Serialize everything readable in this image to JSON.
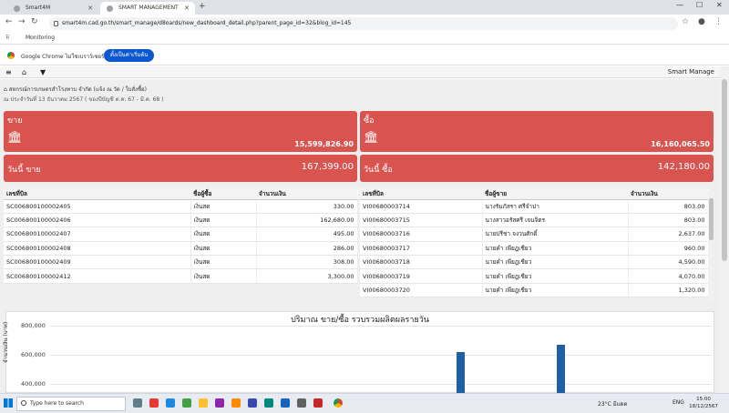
{
  "browser": {
    "tabs": [
      {
        "label": "Smart4M"
      },
      {
        "label": "SMART MANAGEMENT"
      }
    ],
    "url": "smart4m.cad.go.th/smart_manage/d8oards/new_dashboard_detail.php?parent_page_id=32&blog_id=145",
    "bookmark": "Monitoring",
    "infobar_text": "Google Chrome ไม่ใช่เบราว์เซอร์เริ่มต้น",
    "infobar_button": "ตั้งเป็นค่าเริ่มต้น"
  },
  "app": {
    "brand": "Smart Manage",
    "breadcrumb": "สหกรณ์การเกษตรสำโรงทาบ จำกัด (แจ้ง ณ วัด / ใบสั่งซื้อ)",
    "dateline": "ณ ประจำวันที่ 13 ธันวาคม 2567 ( ของปีบัญชี ต.ค. 67 - มี.ค. 68 )"
  },
  "sell": {
    "label": "ขาย",
    "total": "15,599,826.90",
    "today_label": "วันนี้ ขาย",
    "today_amount": "167,399.00",
    "table": {
      "headers": [
        "เลขที่บิล",
        "ชื่อผู้ซื้อ",
        "จำนวนเงิน"
      ],
      "rows": [
        [
          "SC006800100002405",
          "เงินสด",
          "330.00"
        ],
        [
          "SC006800100002406",
          "เงินสด",
          "162,680.00"
        ],
        [
          "SC006800100002407",
          "เงินสด",
          "495.00"
        ],
        [
          "SC006800100002408",
          "เงินสด",
          "286.00"
        ],
        [
          "SC006800100002409",
          "เงินสด",
          "308.00"
        ],
        [
          "SC006800100002412",
          "เงินสด",
          "3,300.00"
        ]
      ]
    }
  },
  "buy": {
    "label": "ซื้อ",
    "total": "16,160,065.50",
    "today_label": "วันนี้ ซื้อ",
    "today_amount": "142,180.00",
    "table": {
      "headers": [
        "เลขที่บิล",
        "ชื่อผู้ขาย",
        "จำนวนเงิน"
      ],
      "rows": [
        [
          "VI00680003714",
          "นางรัมภัสรา ศรีจำปา",
          "803.00"
        ],
        [
          "VI00680003715",
          "นางสาวอรัสศรี เจนจิตร",
          "803.00"
        ],
        [
          "VI00680003716",
          "นายปรีชา จงวนศักดิ์",
          "2,637.00"
        ],
        [
          "VI00680003717",
          "นายคำ เพียฎเชียว",
          "960.00"
        ],
        [
          "VI00680003718",
          "นายคำ เพียฎเชียว",
          "4,590.00"
        ],
        [
          "VI00680003719",
          "นายคำ เพียฎเชียว",
          "4,070.00"
        ],
        [
          "VI00680003720",
          "นายคำ เพียฎเชียว",
          "1,320.00"
        ]
      ]
    }
  },
  "chart_data": {
    "type": "bar",
    "title": "ปริมาณ ขาย/ซื้อ รวบรวมผลิตผลรายวัน",
    "ylabel": "จำนวนเงิน (บาท)",
    "yticks": [
      "800,000",
      "600,000",
      "400,000"
    ],
    "ylim_visible": [
      330000,
      800000
    ],
    "series": [
      {
        "values": [
          620000,
          670000
        ]
      }
    ],
    "color": "#1f5fa5"
  },
  "taskbar": {
    "search_placeholder": "Type here to search",
    "weather": "23°C มีแดด",
    "lang": "ENG",
    "time": "15:00",
    "date": "18/12/2567"
  }
}
